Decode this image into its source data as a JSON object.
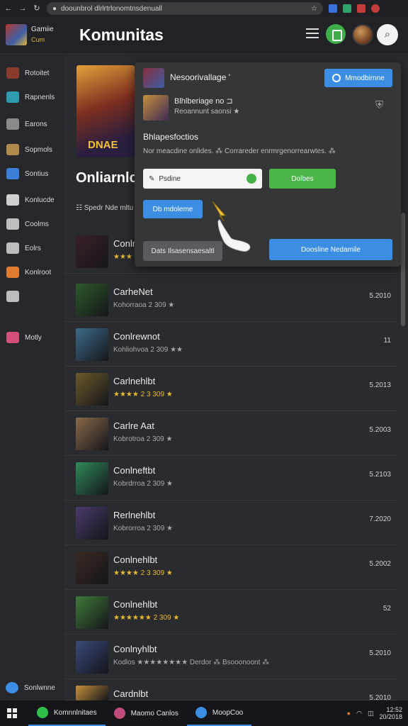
{
  "browser": {
    "url": "doounbrol dlrlrtrlonomtnsdenuall",
    "back": "←",
    "forward": "→",
    "reload": "↻",
    "star": "☆"
  },
  "header": {
    "brand_line1": "Gamiie",
    "brand_line2": "Cum",
    "title": "Komunitas"
  },
  "sidebar": {
    "items": [
      {
        "label": "Rotoitet",
        "icon": "game-avatar-icon",
        "color": "#8a3b2e"
      },
      {
        "label": "Rapnenls",
        "icon": "tree-icon",
        "color": "#2f9bb0"
      },
      {
        "label": "Earons",
        "icon": "gamepad-icon",
        "color": "#8a8a8a"
      },
      {
        "label": "Sopmols",
        "icon": "tools-icon",
        "color": "#b08a4a"
      },
      {
        "label": "Sontius",
        "icon": "shield-icon",
        "color": "#3b7fd9"
      },
      {
        "label": "Konlucde",
        "icon": "chat-icon",
        "color": "#cfcfcf"
      },
      {
        "label": "Coolms",
        "icon": "folder-icon",
        "color": "#bdbdbd"
      },
      {
        "label": "Eolrs",
        "icon": "list-icon",
        "color": "#bdbdbd"
      },
      {
        "label": "Konlroot",
        "icon": "orange-app-icon",
        "color": "#e07a2e"
      },
      {
        "label": "",
        "icon": "mail-icon",
        "color": "#bdbdbd"
      },
      {
        "label": "Motly",
        "icon": "heart-icon",
        "color": "#d4507a"
      }
    ],
    "bottom_label": "Sonlwnne"
  },
  "main": {
    "hero_label": "DNAE",
    "online_title": "Onliarnlclt",
    "filter_text": "Spedr Nde mltu"
  },
  "popup": {
    "title": "Nesoorivallage '",
    "top_button": "Mmodbirnne",
    "user_name": "Blhlberiage no ⊐",
    "user_sub": "Reoannunt saonsi ★",
    "heading": "Bhlapesfoctios",
    "desc": "Nor meacdine onlides. ⁂ Corrareder enrmrgenorrearwtes. ⁂",
    "input_value": "Psdine",
    "green_button": "Dolbes",
    "small_button": "Db mdoleme",
    "gray_button": "Dats Ilsasensaesaltl",
    "large_button": "Doosline Nedamile"
  },
  "rows": [
    {
      "name": "Conlrehat",
      "meta": "★★★",
      "value": "",
      "thumb": "#3a1f2a"
    },
    {
      "name": "CarheNet",
      "meta": "Kohorraoa 2 309 ★",
      "value": "5.2010",
      "thumb": "#2d5a2a"
    },
    {
      "name": "Conlrewnot",
      "meta": "Kohliohvoa 2 309 ★★",
      "value": "11",
      "thumb": "#3d6b8a"
    },
    {
      "name": "Carlnehlbt",
      "meta": "★★★★ 2 3 309 ★",
      "value": "5.2013",
      "thumb": "#6b5a2a"
    },
    {
      "name": "Carlre Aat",
      "meta": "Kobrotroa 2 309 ★",
      "value": "5.2003",
      "thumb": "#8a6a4a"
    },
    {
      "name": "Conlneftbt",
      "meta": "Kobrdrroa 2 309 ★",
      "value": "5.2103",
      "thumb": "#2f8a5a"
    },
    {
      "name": "Rerlnehlbt",
      "meta": "Kobrorroa 2 309 ★",
      "value": "7.2020",
      "thumb": "#4a3b6b"
    },
    {
      "name": "Conlnehlbt",
      "meta": "★★★★ 2 3 309 ★",
      "value": "5.2002",
      "thumb": "#3a2a22"
    },
    {
      "name": "Conlnehlbt",
      "meta": "★★★★★★ 2 309 ★",
      "value": "52",
      "thumb": "#3f7a3a"
    },
    {
      "name": "Conlnyhlbt",
      "meta": "Kodlos ★★★★★★★★ Derdor ⁂ Bsooonoont ⁂",
      "value": "5.2010",
      "thumb": "#3a4a7a"
    },
    {
      "name": "Cardnlbt",
      "meta": "",
      "value": "5.2010",
      "thumb": "#c7903c"
    }
  ],
  "taskbar": {
    "items": [
      {
        "label": "Komnnlnitaes",
        "color": "#2fbf4a"
      },
      {
        "label": "Maomo Canlos",
        "color": "#c24a7a"
      },
      {
        "label": "MoopCoo",
        "color": "#3b8ee4"
      }
    ],
    "clock_line1": "12:52",
    "clock_line2": "20/2018"
  }
}
